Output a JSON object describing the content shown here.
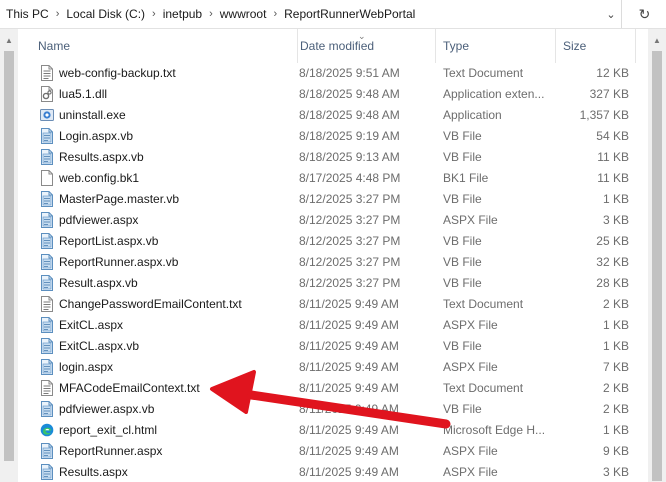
{
  "address": {
    "crumbs": [
      "This PC",
      "Local Disk (C:)",
      "inetpub",
      "wwwroot",
      "ReportRunnerWebPortal"
    ]
  },
  "columns": {
    "name": "Name",
    "date": "Date modified",
    "type": "Type",
    "size": "Size"
  },
  "files": [
    {
      "name": "web-config-backup.txt",
      "date": "8/18/2025 9:51 AM",
      "type": "Text Document",
      "size": "12 KB",
      "icon": "text-file-icon"
    },
    {
      "name": "lua5.1.dll",
      "date": "8/18/2025 9:48 AM",
      "type": "Application exten...",
      "size": "327 KB",
      "icon": "dll-file-icon"
    },
    {
      "name": "uninstall.exe",
      "date": "8/18/2025 9:48 AM",
      "type": "Application",
      "size": "1,357 KB",
      "icon": "exe-file-icon"
    },
    {
      "name": "Login.aspx.vb",
      "date": "8/18/2025 9:19 AM",
      "type": "VB File",
      "size": "54 KB",
      "icon": "code-file-icon"
    },
    {
      "name": "Results.aspx.vb",
      "date": "8/18/2025 9:13 AM",
      "type": "VB File",
      "size": "11 KB",
      "icon": "code-file-icon"
    },
    {
      "name": "web.config.bk1",
      "date": "8/17/2025 4:48 PM",
      "type": "BK1 File",
      "size": "11 KB",
      "icon": "blank-file-icon"
    },
    {
      "name": "MasterPage.master.vb",
      "date": "8/12/2025 3:27 PM",
      "type": "VB File",
      "size": "1 KB",
      "icon": "code-file-icon"
    },
    {
      "name": "pdfviewer.aspx",
      "date": "8/12/2025 3:27 PM",
      "type": "ASPX File",
      "size": "3 KB",
      "icon": "code-file-icon"
    },
    {
      "name": "ReportList.aspx.vb",
      "date": "8/12/2025 3:27 PM",
      "type": "VB File",
      "size": "25 KB",
      "icon": "code-file-icon"
    },
    {
      "name": "ReportRunner.aspx.vb",
      "date": "8/12/2025 3:27 PM",
      "type": "VB File",
      "size": "32 KB",
      "icon": "code-file-icon"
    },
    {
      "name": "Result.aspx.vb",
      "date": "8/12/2025 3:27 PM",
      "type": "VB File",
      "size": "28 KB",
      "icon": "code-file-icon"
    },
    {
      "name": "ChangePasswordEmailContent.txt",
      "date": "8/11/2025 9:49 AM",
      "type": "Text Document",
      "size": "2 KB",
      "icon": "text-file-icon"
    },
    {
      "name": "ExitCL.aspx",
      "date": "8/11/2025 9:49 AM",
      "type": "ASPX File",
      "size": "1 KB",
      "icon": "code-file-icon"
    },
    {
      "name": "ExitCL.aspx.vb",
      "date": "8/11/2025 9:49 AM",
      "type": "VB File",
      "size": "1 KB",
      "icon": "code-file-icon"
    },
    {
      "name": "login.aspx",
      "date": "8/11/2025 9:49 AM",
      "type": "ASPX File",
      "size": "7 KB",
      "icon": "code-file-icon"
    },
    {
      "name": "MFACodeEmailContext.txt",
      "date": "8/11/2025 9:49 AM",
      "type": "Text Document",
      "size": "2 KB",
      "icon": "text-file-icon"
    },
    {
      "name": "pdfviewer.aspx.vb",
      "date": "8/11/2025 9:49 AM",
      "type": "VB File",
      "size": "2 KB",
      "icon": "code-file-icon"
    },
    {
      "name": "report_exit_cl.html",
      "date": "8/11/2025 9:49 AM",
      "type": "Microsoft Edge H...",
      "size": "1 KB",
      "icon": "edge-html-icon"
    },
    {
      "name": "ReportRunner.aspx",
      "date": "8/11/2025 9:49 AM",
      "type": "ASPX File",
      "size": "9 KB",
      "icon": "code-file-icon"
    },
    {
      "name": "Results.aspx",
      "date": "8/11/2025 9:49 AM",
      "type": "ASPX File",
      "size": "3 KB",
      "icon": "code-file-icon"
    }
  ],
  "colors": {
    "header_text": "#4c607a",
    "meta_text": "#6d6d6d",
    "annotation_arrow": "#e0141e"
  }
}
